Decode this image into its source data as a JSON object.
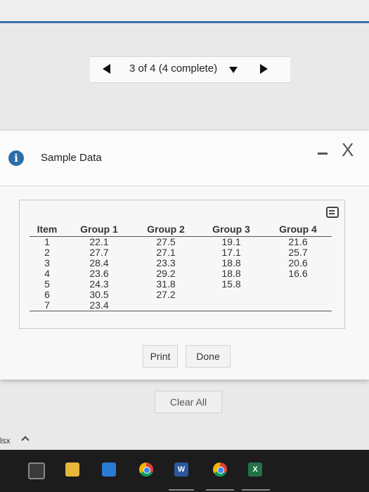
{
  "navigator": {
    "label": "3 of 4 (4 complete)"
  },
  "dialog": {
    "title": "Sample Data",
    "close_symbol": "X",
    "table": {
      "headers": [
        "Item",
        "Group 1",
        "Group 2",
        "Group 3",
        "Group 4"
      ],
      "rows": [
        [
          "1",
          "22.1",
          "27.5",
          "19.1",
          "21.6"
        ],
        [
          "2",
          "27.7",
          "27.1",
          "17.1",
          "25.7"
        ],
        [
          "3",
          "28.4",
          "23.3",
          "18.8",
          "20.6"
        ],
        [
          "4",
          "23.6",
          "29.2",
          "18.8",
          "16.6"
        ],
        [
          "5",
          "24.3",
          "31.8",
          "15.8",
          ""
        ],
        [
          "6",
          "30.5",
          "27.2",
          "",
          ""
        ],
        [
          "7",
          "23.4",
          "",
          "",
          ""
        ]
      ]
    },
    "buttons": {
      "print": "Print",
      "done": "Done"
    }
  },
  "page": {
    "clear_all": "Clear All"
  },
  "downloads": {
    "label": "lsx"
  },
  "taskbar": {
    "word_letter": "W",
    "excel_letter": "X"
  },
  "colors": {
    "accent": "#3f6fa8",
    "info_icon": "#2c6ea8"
  }
}
